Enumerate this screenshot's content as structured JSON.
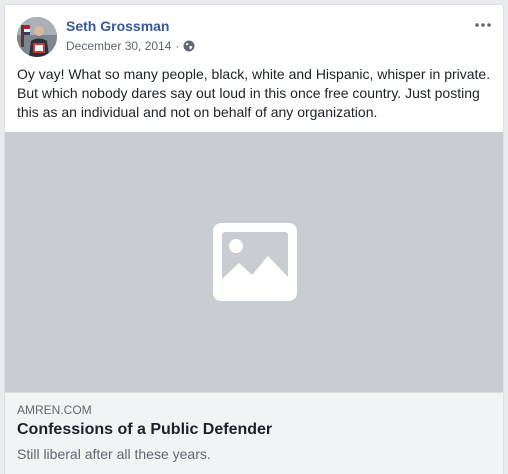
{
  "post": {
    "author": "Seth Grossman",
    "date": "December 30, 2014",
    "separator": "·",
    "privacy_icon": "globe-icon",
    "more_icon": "more-options-icon",
    "text": "Oy vay! What so many people, black, white and Hispanic, whisper in private. But which nobody dares say out loud in this once free country. Just posting this as an individual and not on behalf of any organization."
  },
  "link_preview": {
    "image_icon": "image-placeholder-icon",
    "domain": "AMREN.COM",
    "title": "Confessions of a Public Defender",
    "description": "Still liberal after all these years."
  },
  "colors": {
    "author_link": "#385898",
    "text": "#1d2129",
    "secondary_text": "#616770",
    "media_placeholder": "#c9ccd1",
    "link_background": "#f2f3f5",
    "page_background": "#e9ebee"
  }
}
